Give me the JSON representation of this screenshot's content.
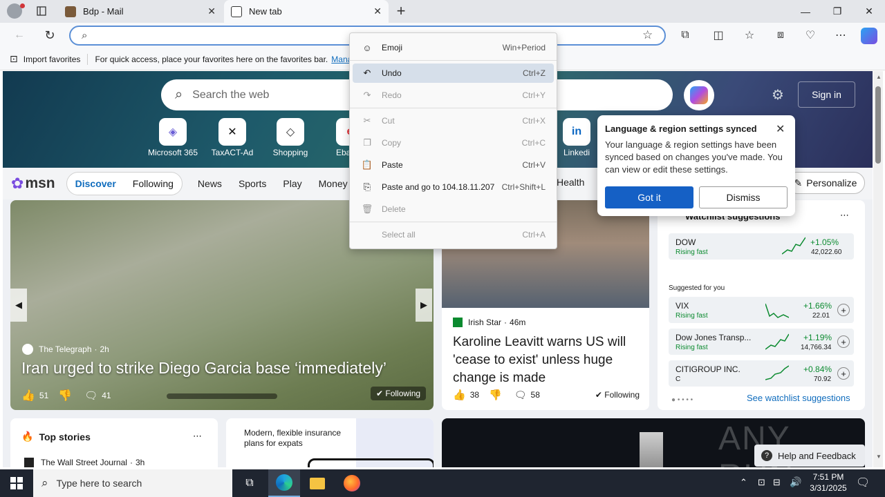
{
  "browser": {
    "tabs": [
      {
        "title": "Bdp - Mail"
      },
      {
        "title": "New tab"
      }
    ],
    "new_tab_label": "+",
    "address_placeholder": "",
    "favorites": {
      "import_label": "Import favorites",
      "hint": "For quick access, place your favorites here on the favorites bar.",
      "manage_link": "Mana"
    }
  },
  "newtab": {
    "search_placeholder": "Search the web",
    "sign_in": "Sign in",
    "quick_links": [
      {
        "label": "Microsoft 365",
        "glyph": "◈"
      },
      {
        "label": "TaxACT-Ad",
        "glyph": "✕"
      },
      {
        "label": "Shopping",
        "glyph": "◇"
      },
      {
        "label": "Ebay",
        "glyph": "e"
      },
      {
        "label": "Linkedi",
        "glyph": "in"
      }
    ],
    "msn_logo": "msn",
    "nav": {
      "discover": "Discover",
      "following": "Following",
      "items": [
        "News",
        "Sports",
        "Play",
        "Money"
      ],
      "health": "Health",
      "personalize": "Personalize"
    },
    "hero_story": {
      "source": "The Telegraph",
      "age": "2h",
      "headline": "Iran urged to strike Diego Garcia base ‘immediately’",
      "likes": "51",
      "comments": "41",
      "following": "Following"
    },
    "side_story": {
      "source": "Irish Star",
      "age": "46m",
      "headline": "Karoline Leavitt warns US will 'cease to exist' unless huge change is made",
      "likes": "38",
      "comments": "58",
      "following": "Following"
    },
    "watchlist": {
      "title": "Watchlist suggestions",
      "suggested_label": "Suggested for you",
      "see_more": "See watchlist suggestions",
      "top": {
        "name": "DOW",
        "status": "Rising fast",
        "change": "+1.05%",
        "value": "42,022.60"
      },
      "items": [
        {
          "name": "VIX",
          "status": "Rising fast",
          "change": "+1.66%",
          "value": "22.01"
        },
        {
          "name": "Dow Jones Transp...",
          "status": "Rising fast",
          "change": "+1.19%",
          "value": "14,766.34"
        },
        {
          "name": "CITIGROUP INC.",
          "status": "C",
          "change": "+0.84%",
          "value": "70.92"
        }
      ]
    },
    "top_stories": {
      "title": "Top stories",
      "source": "The Wall Street Journal",
      "age": "3h"
    },
    "ad": {
      "text": "Modern, flexible insurance plans for expats"
    },
    "help": "Help and Feedback",
    "watermark": "ANY RUN"
  },
  "context_menu": {
    "items": [
      {
        "label": "Emoji",
        "shortcut": "Win+Period",
        "icon": "☺",
        "enabled": true
      },
      {
        "label": "Undo",
        "shortcut": "Ctrl+Z",
        "icon": "↶",
        "enabled": true
      },
      {
        "label": "Redo",
        "shortcut": "Ctrl+Y",
        "icon": "↷",
        "enabled": false
      },
      {
        "label": "Cut",
        "shortcut": "Ctrl+X",
        "icon": "✂",
        "enabled": false
      },
      {
        "label": "Copy",
        "shortcut": "Ctrl+C",
        "icon": "❐",
        "enabled": false
      },
      {
        "label": "Paste",
        "shortcut": "Ctrl+V",
        "icon": "📋",
        "enabled": true
      },
      {
        "label": "Paste and go to 104.18.11.207",
        "shortcut": "Ctrl+Shift+L",
        "icon": "⎘",
        "enabled": true
      },
      {
        "label": "Delete",
        "shortcut": "",
        "icon": "🗑",
        "enabled": false
      },
      {
        "label": "Select all",
        "shortcut": "Ctrl+A",
        "icon": "",
        "enabled": false
      }
    ]
  },
  "popup": {
    "title": "Language & region settings synced",
    "body": "Your language & region settings have been synced based on changes you've made. You can view or edit these settings.",
    "primary": "Got it",
    "secondary": "Dismiss"
  },
  "taskbar": {
    "search_placeholder": "Type here to search",
    "time": "7:51 PM",
    "date": "3/31/2025"
  },
  "colors": {
    "accent": "#0f6cbd",
    "primary_button": "#1560c5",
    "stock_green": "#0b8a2f",
    "taskbar": "#1f2530"
  }
}
